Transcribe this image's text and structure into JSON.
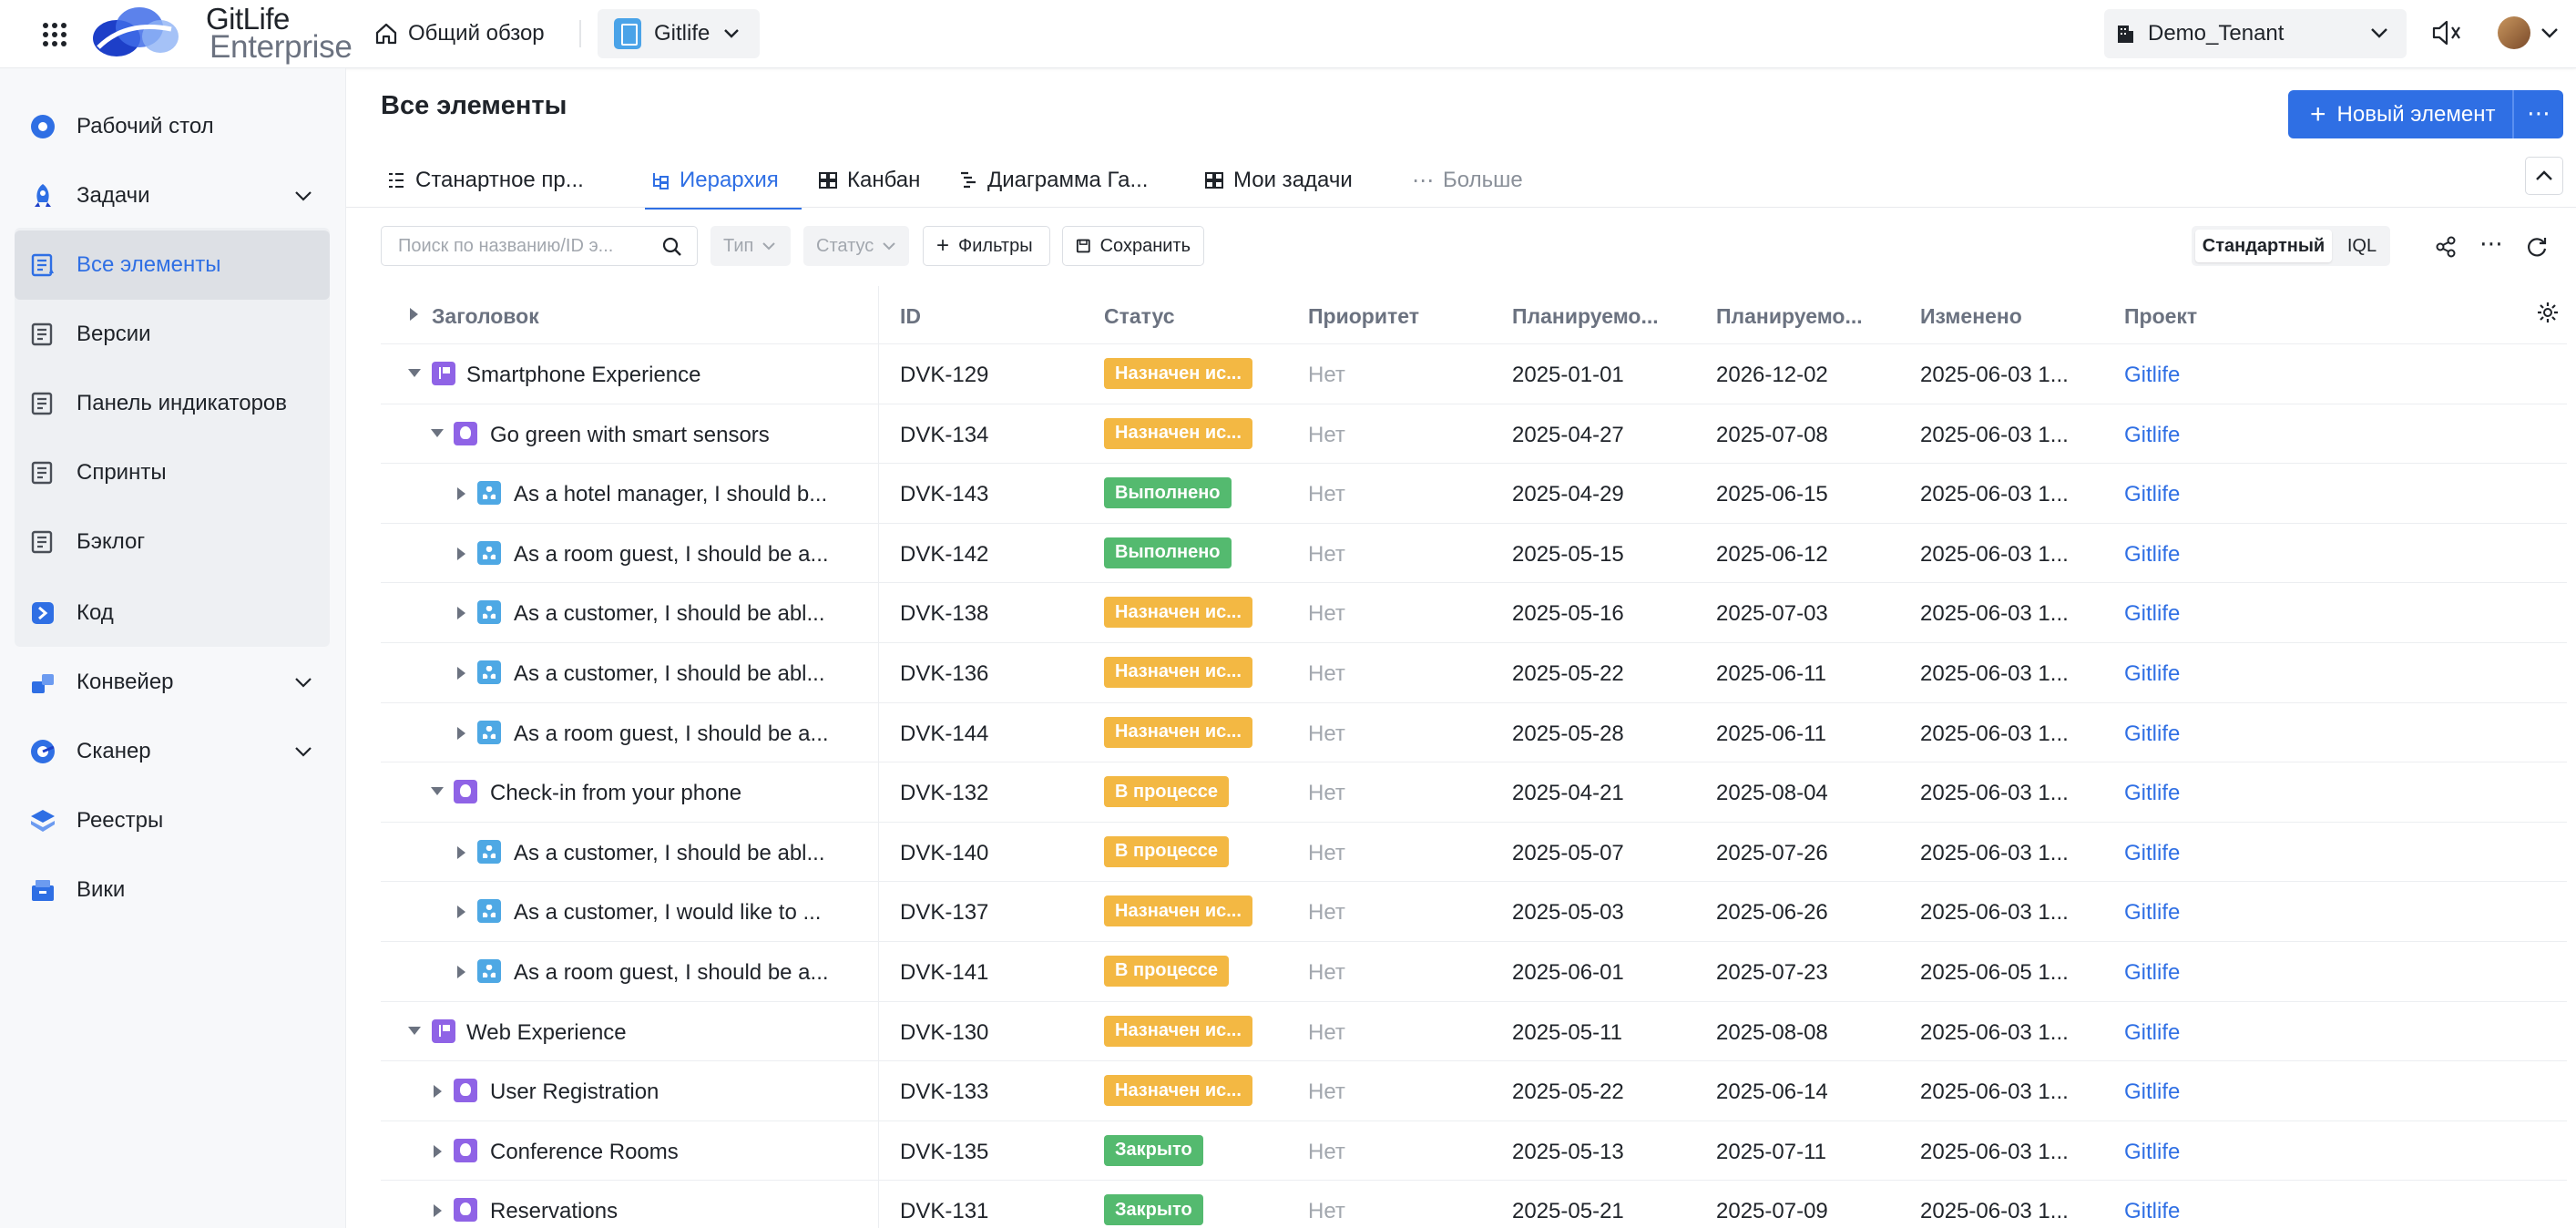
{
  "header": {
    "brand_line1": "GitLife",
    "brand_line2": "Enterprise",
    "overview_label": "Общий обзор",
    "project_name": "Gitlife",
    "tenant_name": "Demo_Tenant"
  },
  "sidebar": {
    "items": [
      {
        "label": "Рабочий стол",
        "icon": "dashboard-icon"
      },
      {
        "label": "Задачи",
        "icon": "rocket-icon"
      },
      {
        "label": "Все элементы",
        "icon": "list-icon"
      },
      {
        "label": "Версии",
        "icon": "list-icon"
      },
      {
        "label": "Панель индикаторов",
        "icon": "list-icon"
      },
      {
        "label": "Спринты",
        "icon": "list-icon"
      },
      {
        "label": "Бэклог",
        "icon": "list-icon"
      },
      {
        "label": "Код",
        "icon": "code-icon"
      },
      {
        "label": "Конвейер",
        "icon": "pipeline-icon"
      },
      {
        "label": "Сканер",
        "icon": "scanner-icon"
      },
      {
        "label": "Реестры",
        "icon": "registry-icon"
      },
      {
        "label": "Вики",
        "icon": "wiki-icon"
      }
    ]
  },
  "main": {
    "title": "Все элементы",
    "new_button": "Новый элемент",
    "tabs": [
      {
        "label": "Станартное пр..."
      },
      {
        "label": "Иерархия"
      },
      {
        "label": "Канбан"
      },
      {
        "label": "Диаграмма Га..."
      },
      {
        "label": "Мои задачи"
      },
      {
        "label": "Больше"
      }
    ],
    "toolbar": {
      "search_placeholder": "Поиск по названию/ID э...",
      "type_label": "Тип",
      "status_label": "Статус",
      "filters_label": "Фильтры",
      "save_label": "Сохранить",
      "view_standard": "Стандартный",
      "view_iql": "IQL"
    },
    "columns": [
      "Заголовок",
      "ID",
      "Статус",
      "Приоритет",
      "Планируемо...",
      "Планируемо...",
      "Изменено",
      "Проект"
    ],
    "rows": [
      {
        "title": "Smartphone Experience",
        "id": "DVK-129",
        "status": "Назначен ис...",
        "priority": "Нет",
        "start": "2025-01-01",
        "end": "2026-12-02",
        "modified": "2025-06-03 1...",
        "project": "Gitlife"
      },
      {
        "title": "Go green with smart sensors",
        "id": "DVK-134",
        "status": "Назначен ис...",
        "priority": "Нет",
        "start": "2025-04-27",
        "end": "2025-07-08",
        "modified": "2025-06-03 1...",
        "project": "Gitlife"
      },
      {
        "title": "As a hotel manager, I should b...",
        "id": "DVK-143",
        "status": "Выполнено",
        "priority": "Нет",
        "start": "2025-04-29",
        "end": "2025-06-15",
        "modified": "2025-06-03 1...",
        "project": "Gitlife"
      },
      {
        "title": "As a room guest, I should be a...",
        "id": "DVK-142",
        "status": "Выполнено",
        "priority": "Нет",
        "start": "2025-05-15",
        "end": "2025-06-12",
        "modified": "2025-06-03 1...",
        "project": "Gitlife"
      },
      {
        "title": "As a customer, I should be abl...",
        "id": "DVK-138",
        "status": "Назначен ис...",
        "priority": "Нет",
        "start": "2025-05-16",
        "end": "2025-07-03",
        "modified": "2025-06-03 1...",
        "project": "Gitlife"
      },
      {
        "title": "As a customer, I should be abl...",
        "id": "DVK-136",
        "status": "Назначен ис...",
        "priority": "Нет",
        "start": "2025-05-22",
        "end": "2025-06-11",
        "modified": "2025-06-03 1...",
        "project": "Gitlife"
      },
      {
        "title": "As a room guest, I should be a...",
        "id": "DVK-144",
        "status": "Назначен ис...",
        "priority": "Нет",
        "start": "2025-05-28",
        "end": "2025-06-11",
        "modified": "2025-06-03 1...",
        "project": "Gitlife"
      },
      {
        "title": "Check-in from your phone",
        "id": "DVK-132",
        "status": "В процессе",
        "priority": "Нет",
        "start": "2025-04-21",
        "end": "2025-08-04",
        "modified": "2025-06-03 1...",
        "project": "Gitlife"
      },
      {
        "title": "As a customer, I should be abl...",
        "id": "DVK-140",
        "status": "В процессе",
        "priority": "Нет",
        "start": "2025-05-07",
        "end": "2025-07-26",
        "modified": "2025-06-03 1...",
        "project": "Gitlife"
      },
      {
        "title": "As a customer, I would like to ...",
        "id": "DVK-137",
        "status": "Назначен ис...",
        "priority": "Нет",
        "start": "2025-05-03",
        "end": "2025-06-26",
        "modified": "2025-06-03 1...",
        "project": "Gitlife"
      },
      {
        "title": "As a room guest, I should be a...",
        "id": "DVK-141",
        "status": "В процессе",
        "priority": "Нет",
        "start": "2025-06-01",
        "end": "2025-07-23",
        "modified": "2025-06-05 1...",
        "project": "Gitlife"
      },
      {
        "title": "Web Experience",
        "id": "DVK-130",
        "status": "Назначен ис...",
        "priority": "Нет",
        "start": "2025-05-11",
        "end": "2025-08-08",
        "modified": "2025-06-03 1...",
        "project": "Gitlife"
      },
      {
        "title": "User Registration",
        "id": "DVK-133",
        "status": "Назначен ис...",
        "priority": "Нет",
        "start": "2025-05-22",
        "end": "2025-06-14",
        "modified": "2025-06-03 1...",
        "project": "Gitlife"
      },
      {
        "title": "Conference Rooms",
        "id": "DVK-135",
        "status": "Закрыто",
        "priority": "Нет",
        "start": "2025-05-13",
        "end": "2025-07-11",
        "modified": "2025-06-03 1...",
        "project": "Gitlife"
      },
      {
        "title": "Reservations",
        "id": "DVK-131",
        "status": "Закрыто",
        "priority": "Нет",
        "start": "2025-05-21",
        "end": "2025-07-09",
        "modified": "2025-06-03 1...",
        "project": "Gitlife"
      }
    ]
  },
  "colors": {
    "accent": "#2f6fe4",
    "badge_assigned": "#f3b843",
    "badge_done": "#54ba6f",
    "epic_icon": "#8f63e6",
    "story_icon": "#4ea8e4"
  }
}
